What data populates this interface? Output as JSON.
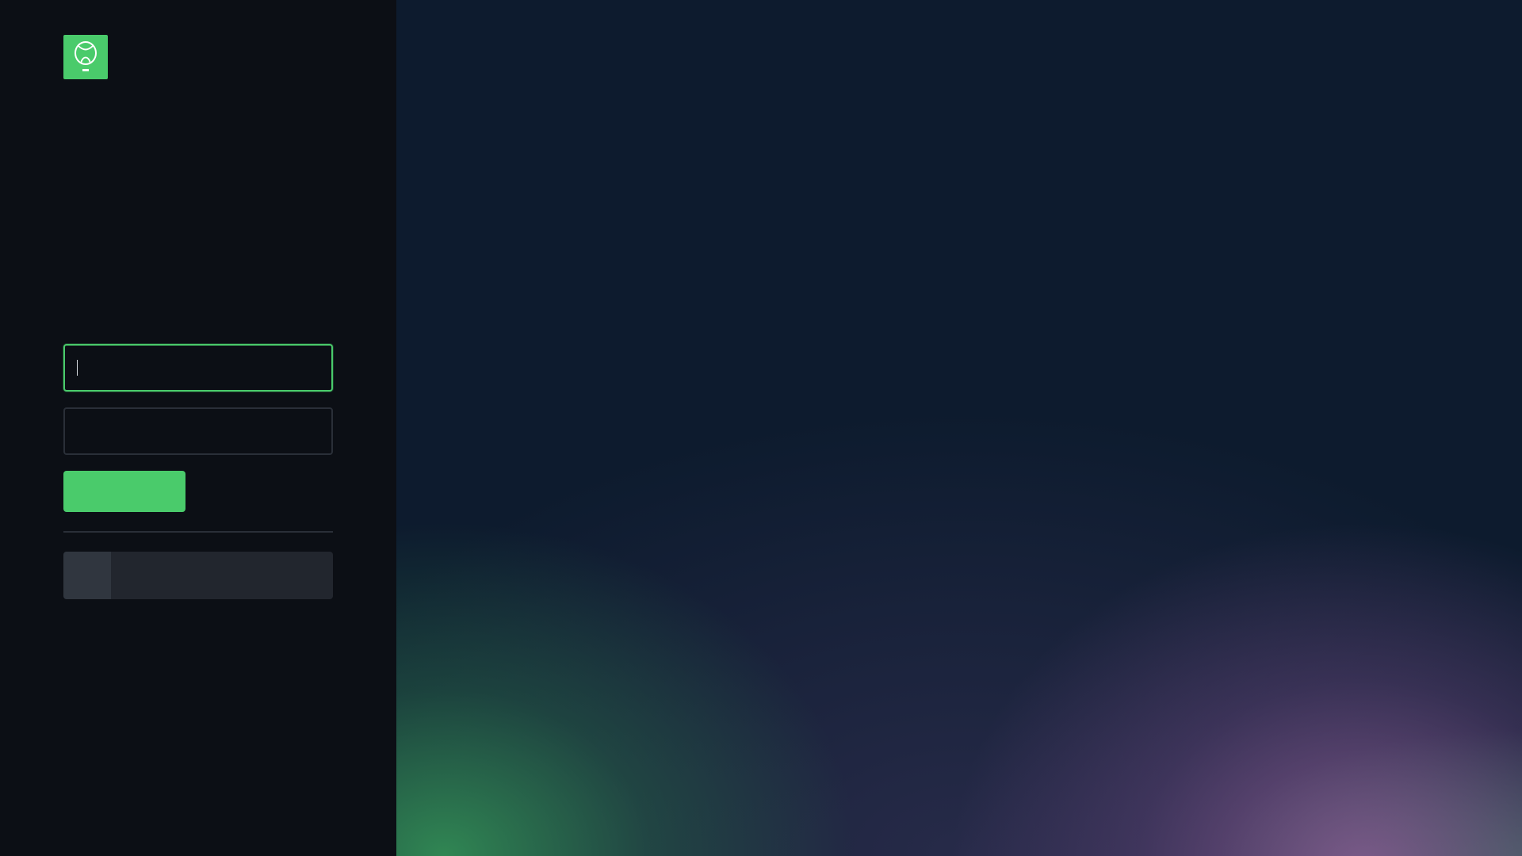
{
  "brand": {
    "logo_icon": "ubiquiti-u-logo-icon",
    "accent_color": "#4acb6b"
  },
  "login_form": {
    "username_value": "",
    "password_value": "",
    "submit_label": ""
  },
  "alternate_login": {
    "icon": "account-icon",
    "label": ""
  },
  "colors": {
    "sidebar_bg": "#0c0f15",
    "hero_bg": "#0d1b2e",
    "field_border": "#2a2f38",
    "field_border_focused": "#4acb6b",
    "button_bg": "#4acb6b"
  }
}
